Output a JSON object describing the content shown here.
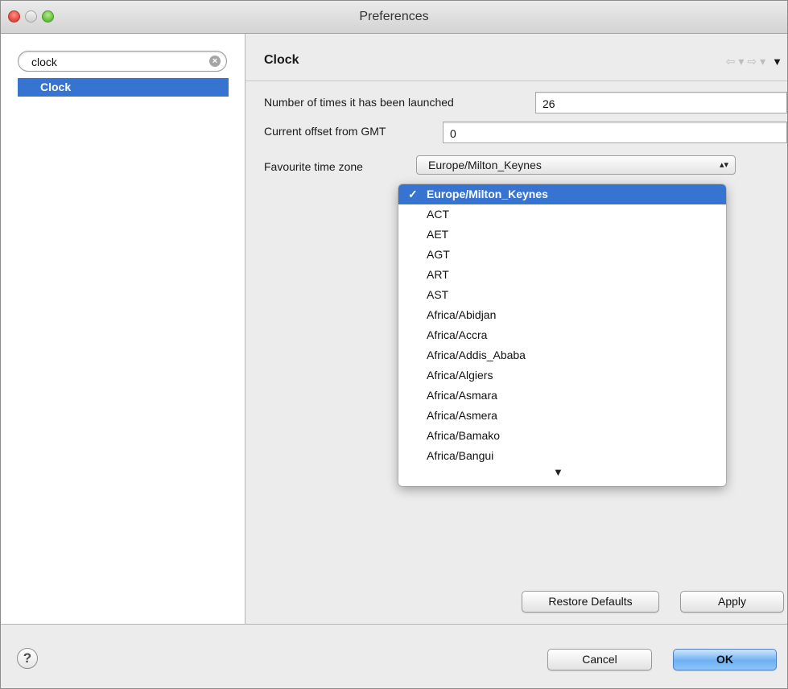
{
  "window": {
    "title": "Preferences"
  },
  "sidebar": {
    "search": {
      "value": "clock",
      "clear_icon": "clear-icon"
    },
    "items": [
      {
        "label": "Clock",
        "selected": true
      }
    ]
  },
  "page": {
    "title": "Clock",
    "nav": {
      "back": "⇦",
      "forward": "⇨",
      "menu": "▼"
    },
    "fields": {
      "launch_count": {
        "label": "Number of times it has been launched",
        "value": "26"
      },
      "gmt_offset": {
        "label": "Current offset from GMT",
        "value": "0"
      },
      "timezone": {
        "label": "Favourite time zone",
        "value": "Europe/Milton_Keynes"
      }
    },
    "buttons": {
      "restore": "Restore Defaults",
      "apply": "Apply"
    }
  },
  "dropdown": {
    "check": "✓",
    "options": [
      "Europe/Milton_Keynes",
      "ACT",
      "AET",
      "AGT",
      "ART",
      "AST",
      "Africa/Abidjan",
      "Africa/Accra",
      "Africa/Addis_Ababa",
      "Africa/Algiers",
      "Africa/Asmara",
      "Africa/Asmera",
      "Africa/Bamako",
      "Africa/Bangui"
    ],
    "more_indicator": "▼"
  },
  "footer": {
    "help": "?",
    "cancel": "Cancel",
    "ok": "OK"
  },
  "colors": {
    "selection": "#3774d2",
    "default_button": "#6db1f3"
  }
}
